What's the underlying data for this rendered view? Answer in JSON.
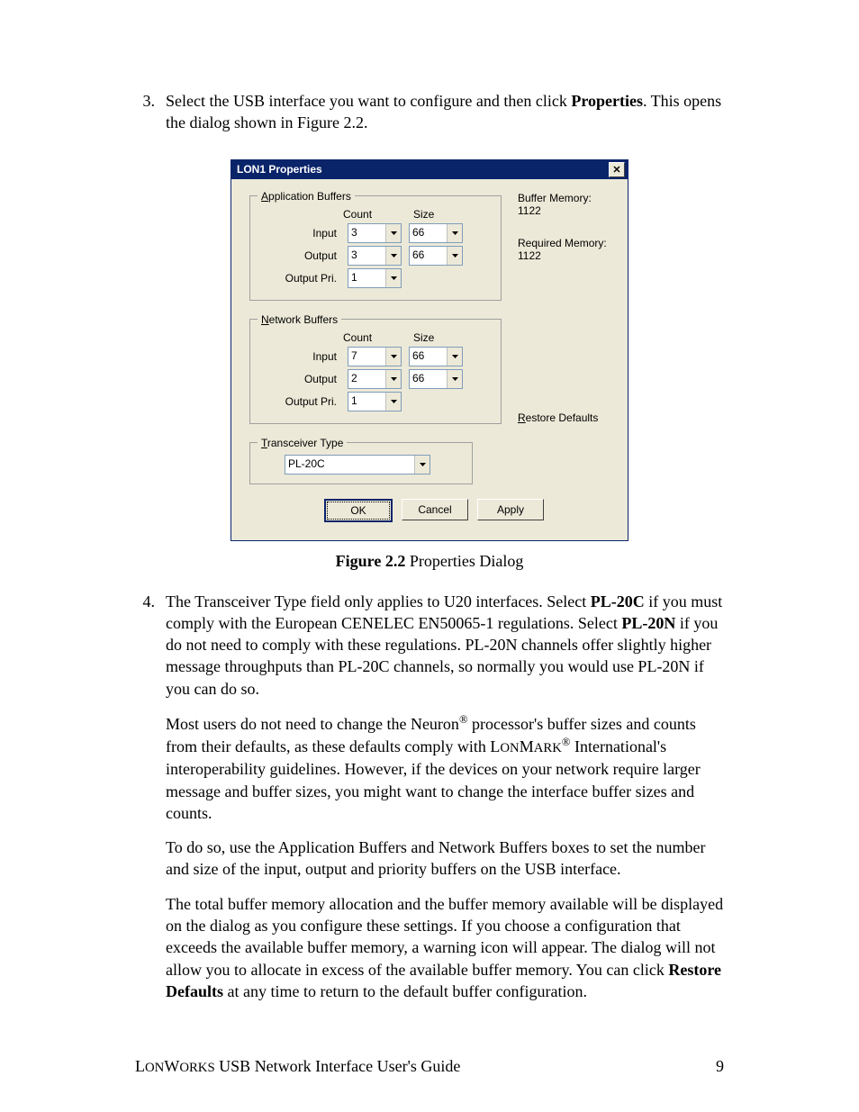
{
  "step3": {
    "num": "3.",
    "line1a": "Select the USB interface you want to configure and then click ",
    "line1b": "Properties",
    "line1c": ".  This opens the dialog shown in Figure 2.2."
  },
  "dialog": {
    "title": "LON1 Properties",
    "close_glyph": "✕",
    "app_buffers": {
      "legend_u": "A",
      "legend_rest": "pplication Buffers",
      "count_hdr": "Count",
      "size_hdr": "Size",
      "rows": [
        {
          "label": "Input",
          "count": "3",
          "size": "66"
        },
        {
          "label": "Output",
          "count": "3",
          "size": "66"
        },
        {
          "label": "Output Pri.",
          "count": "1",
          "size": ""
        }
      ]
    },
    "net_buffers": {
      "legend_u": "N",
      "legend_rest": "etwork Buffers",
      "count_hdr": "Count",
      "size_hdr": "Size",
      "rows": [
        {
          "label": "Input",
          "count": "7",
          "size": "66"
        },
        {
          "label": "Output",
          "count": "2",
          "size": "66"
        },
        {
          "label": "Output Pri.",
          "count": "1",
          "size": ""
        }
      ]
    },
    "buffer_memory_label": "Buffer Memory:",
    "buffer_memory_value": "1122",
    "required_memory_label": "Required Memory:",
    "required_memory_value": "1122",
    "restore_u": "R",
    "restore_rest": "estore Defaults",
    "transceiver": {
      "legend_u": "T",
      "legend_rest": "ransceiver Type",
      "value": "PL-20C"
    },
    "buttons": {
      "ok": "OK",
      "cancel": "Cancel",
      "apply": "Apply"
    }
  },
  "figure": {
    "bold": "Figure 2.2",
    "rest": " Properties Dialog"
  },
  "step4": {
    "num": "4.",
    "p1": "The Transceiver Type field only applies to U20 interfaces.  Select <b>PL-20C</b> if you must comply with the European CENELEC EN50065-1 regulations.  Select <b>PL-20N</b> if you do not need to comply with these regulations.  PL-20N channels offer slightly higher message throughputs than PL-20C channels, so normally you would use PL-20N if you can do so.",
    "p2a": "Most users do not need to change the Neuron",
    "p2b": " processor's buffer sizes and counts from their defaults, as these defaults comply with ",
    "p2c": "L",
    "p2d": "ON",
    "p2e": "M",
    "p2f": "ARK",
    "p2g": " International's interoperability guidelines.  However, if the devices on your network require larger message and buffer sizes, you might want to change the interface buffer sizes and counts.",
    "p3": "To do so, use the Application Buffers and Network Buffers boxes to set the number and size of the input, output and priority buffers on the USB interface.",
    "p4a": "The total buffer memory allocation and the buffer memory available will be displayed on the dialog as you configure these settings.  If you choose a configuration that exceeds the available buffer memory, a warning icon will appear.  The dialog will not allow you to allocate in excess of the available buffer memory.  You can click ",
    "p4b": "Restore Defaults",
    "p4c": " at any time to return to the default buffer configuration."
  },
  "footer": {
    "left_a": "L",
    "left_b": "ON",
    "left_c": "W",
    "left_d": "ORKS",
    "left_rest": " USB Network Interface User's Guide",
    "page": "9"
  }
}
